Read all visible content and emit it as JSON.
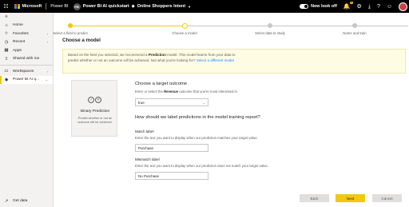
{
  "topbar": {
    "brand_ms": "Microsoft",
    "brand_product": "Power BI",
    "workspace_initials": "PB",
    "breadcrumb_workspace": "Power BI AI quickstart",
    "breadcrumb_item": "Online Shoppers Intent",
    "newlook_label": "New look off",
    "notification_count": "1"
  },
  "sidebar": {
    "items": [
      {
        "icon": "home-icon",
        "label": "Home"
      },
      {
        "icon": "star-icon",
        "label": "Favorites"
      },
      {
        "icon": "clock-icon",
        "label": "Recent"
      },
      {
        "icon": "apps-icon",
        "label": "Apps"
      },
      {
        "icon": "share-icon",
        "label": "Shared with me"
      }
    ],
    "workspaces_label": "Workspaces",
    "current_workspace_label": "Power BI AI q...",
    "get_data_label": "Get data"
  },
  "stepper": {
    "steps": [
      {
        "label": "Select a field to predict",
        "state": "done"
      },
      {
        "label": "Choose a model",
        "state": "current"
      },
      {
        "label": "Select data to study",
        "state": "todo"
      },
      {
        "label": "Name and train",
        "state": "todo"
      }
    ]
  },
  "page": {
    "title": "Choose a model",
    "info_part1": "Based on the field you selected, we recommend a ",
    "info_bold": "Prediction",
    "info_part2": " model. This model learns from your data to",
    "info_line2a": "predict whether or not an outcome will be achieved. Not what you're looking for? ",
    "info_link": "Select a different model"
  },
  "model_card": {
    "name": "Binary Prediction",
    "description": "Predict whether or not an outcome will be achieved."
  },
  "target": {
    "title": "Choose a target outcome",
    "hint_before": "Enter or select the ",
    "hint_bold": "Revenue",
    "hint_after": " outcome that you're most interested in.",
    "value": "true"
  },
  "labels": {
    "title": "How should we label predictions in the model training report?",
    "match_label": "Match label",
    "match_hint": "Enter the text you want to display when our prediction matches your target value.",
    "match_value": "Purchase",
    "mismatch_label": "Mismatch label",
    "mismatch_hint": "Enter the text you want to display when our prediction does not match your target value.",
    "mismatch_value": "No Purchase"
  },
  "buttons": {
    "back": "Back",
    "next": "Next",
    "cancel": "Cancel"
  },
  "colors": {
    "accent": "#f2c811",
    "link": "#118dff",
    "topbar": "#000000"
  }
}
